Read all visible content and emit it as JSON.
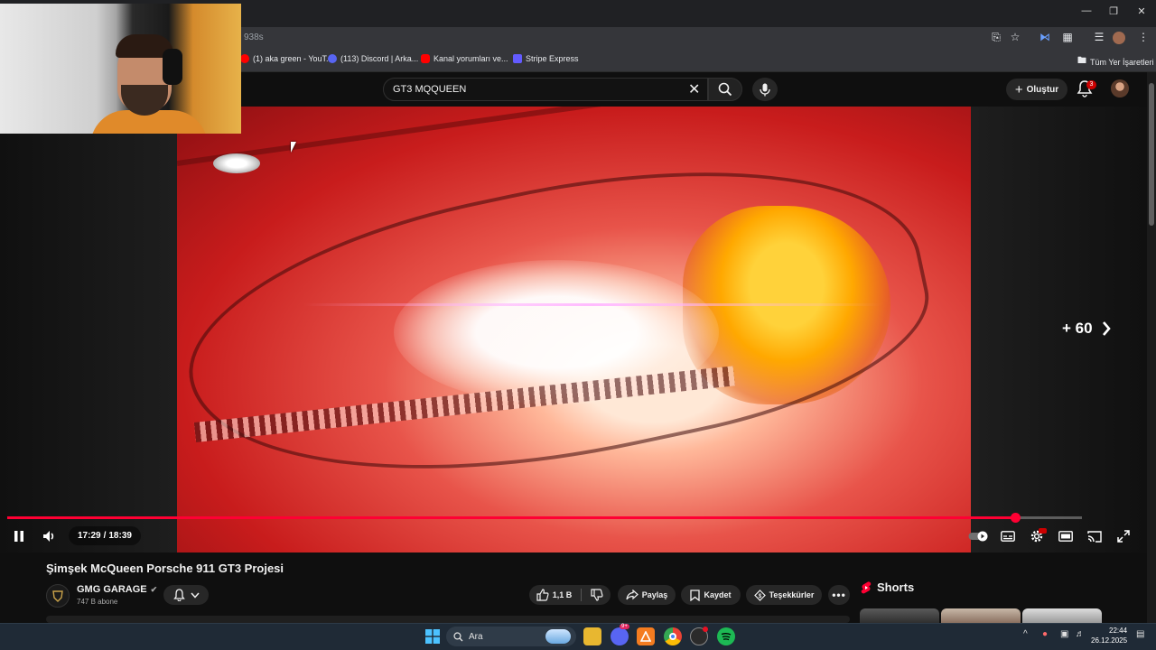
{
  "browser": {
    "url_fragment": "938s",
    "bookmarks": [
      {
        "label": "(1) aka green - YouT...",
        "color": "#ff0000"
      },
      {
        "label": "(113) Discord | Arka...",
        "color": "#5865f2"
      },
      {
        "label": "Kanal yorumları ve...",
        "color": "#ff0000"
      },
      {
        "label": "Stripe Express",
        "color": "#635bff"
      }
    ],
    "all_bookmarks_label": "Tüm Yer İşaretleri"
  },
  "youtube": {
    "search_value": "GT3 MQQUEEN",
    "create_label": "Oluştur",
    "notification_count": "3"
  },
  "player": {
    "skip_label": "+ 60",
    "time_current": "17:29",
    "time_separator": "/",
    "time_total": "18:39",
    "progress_fraction": 0.9376,
    "accent_color": "#ff0033"
  },
  "video": {
    "title": "Şimşek McQueen Porsche 911 GT3 Projesi",
    "channel_name": "GMG GARAGE",
    "subscribers": "747 B abone",
    "like_count": "1,1 B",
    "share_label": "Paylaş",
    "save_label": "Kaydet",
    "thanks_label": "Teşekkürler"
  },
  "sidebar": {
    "shorts_label": "Shorts"
  },
  "taskbar": {
    "search_label": "Ara",
    "discord_badge": "9+",
    "time": "22:44",
    "date": "26.12.2025"
  }
}
